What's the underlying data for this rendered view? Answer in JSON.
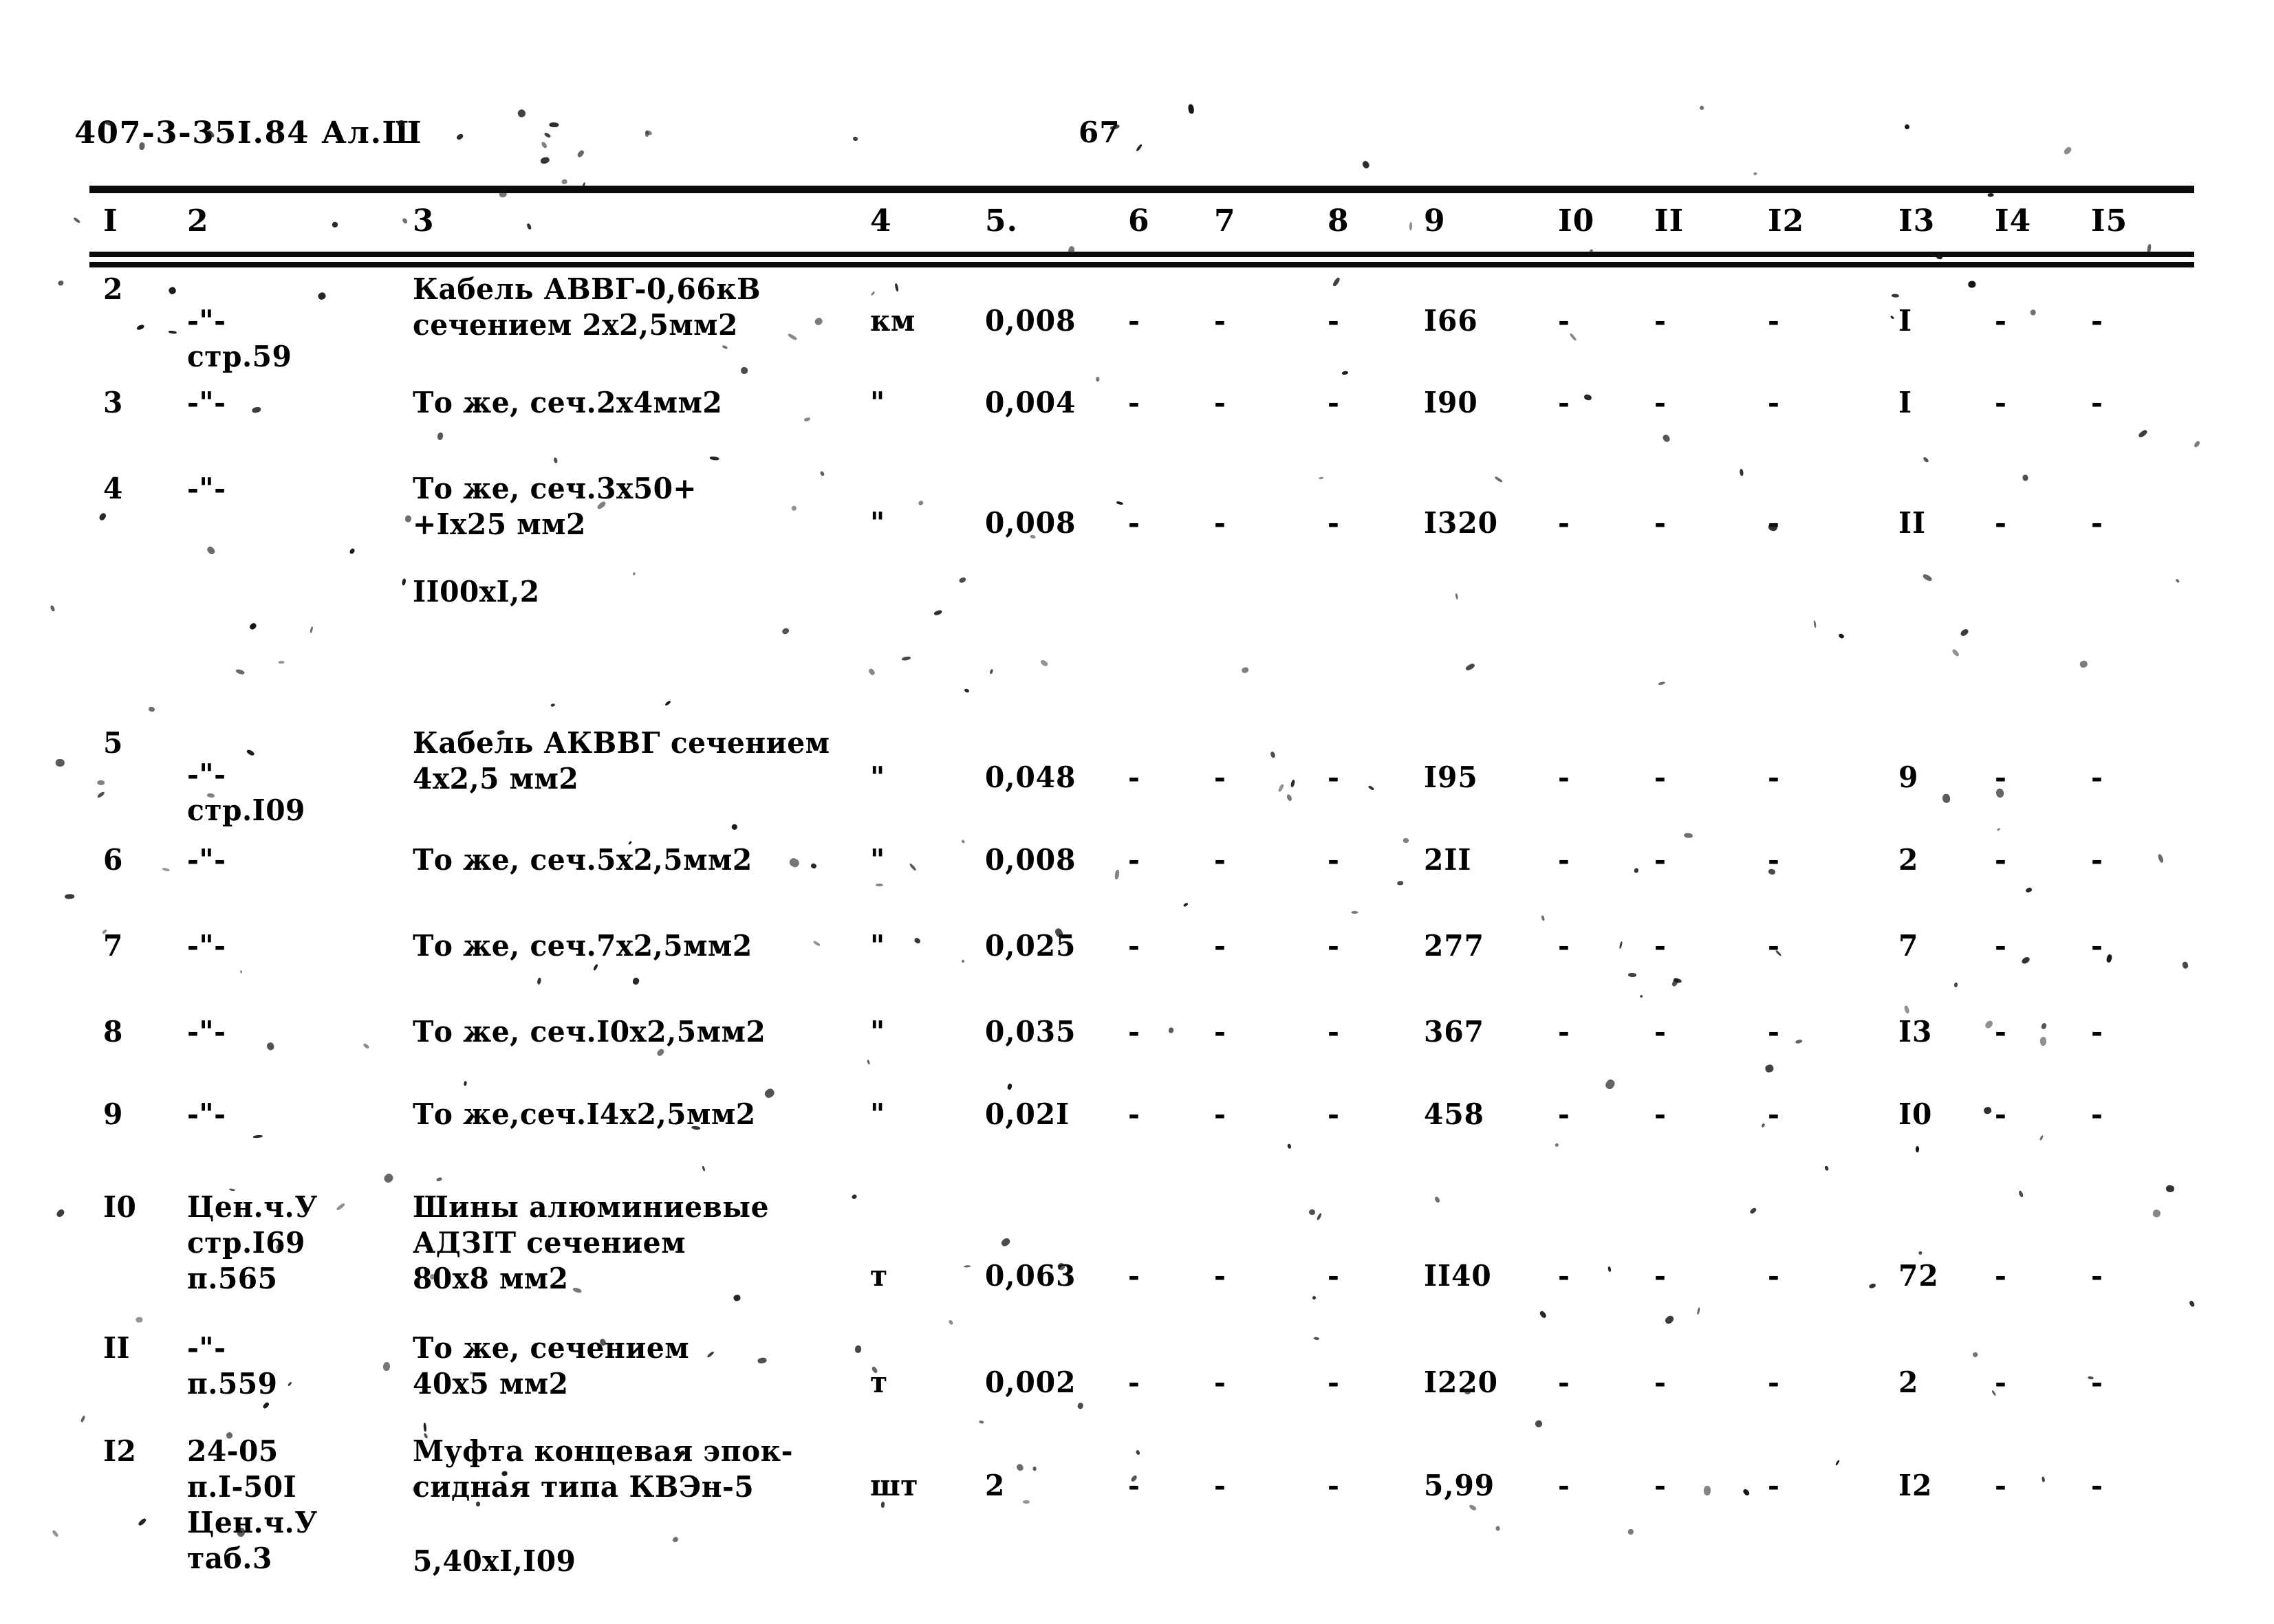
{
  "header": {
    "doc_code": "407-3-35I.84 Ал.Ш",
    "page_number": "67"
  },
  "table": {
    "column_headers": [
      "I",
      "2",
      "3",
      "4",
      "5.",
      "6",
      "7",
      "8",
      "9",
      "I0",
      "II",
      "I2",
      "I3",
      "I4",
      "I5"
    ],
    "rows": [
      {
        "c1": "2",
        "c2": "-\"-\nстр.59",
        "c3": "Кабель АВВГ-0,66кВ\nсечением 2х2,5мм2",
        "c4": "км",
        "c5": "0,008",
        "c6": "-",
        "c7": "-",
        "c8": "-",
        "c9": "I66",
        "c10": "-",
        "c11": "-",
        "c12": "-",
        "c13": "I",
        "c14": "-",
        "c15": "-"
      },
      {
        "c1": "3",
        "c2": "-\"-",
        "c3": "То же, сеч.2х4мм2",
        "c4": "\"",
        "c5": "0,004",
        "c6": "-",
        "c7": "-",
        "c8": "-",
        "c9": "I90",
        "c10": "-",
        "c11": "-",
        "c12": "-",
        "c13": "I",
        "c14": "-",
        "c15": "-"
      },
      {
        "c1": "4",
        "c2": "-\"-",
        "c3": "То же, сеч.3х50+\n+Iх25 мм2",
        "c3_extra": "II00xI,2",
        "c4": "\"",
        "c5": "0,008",
        "c6": "-",
        "c7": "-",
        "c8": "-",
        "c9": "I320",
        "c10": "-",
        "c11": "-",
        "c12": "-",
        "c13": "II",
        "c14": "-",
        "c15": "-"
      },
      {
        "c1": "5",
        "c2": "-\"-\nстр.I09",
        "c3": "Кабель АКВВГ сечением\n4х2,5 мм2",
        "c4": "\"",
        "c5": "0,048",
        "c6": "-",
        "c7": "-",
        "c8": "-",
        "c9": "I95",
        "c10": "-",
        "c11": "-",
        "c12": "-",
        "c13": "9",
        "c14": "-",
        "c15": "-"
      },
      {
        "c1": "6",
        "c2": "-\"-",
        "c3": "То же, сеч.5х2,5мм2",
        "c4": "\"",
        "c5": "0,008",
        "c6": "-",
        "c7": "-",
        "c8": "-",
        "c9": "2II",
        "c10": "-",
        "c11": "-",
        "c12": "-",
        "c13": "2",
        "c14": "-",
        "c15": "-"
      },
      {
        "c1": "7",
        "c2": "-\"-",
        "c3": "То же, сеч.7х2,5мм2",
        "c4": "\"",
        "c5": "0,025",
        "c6": "-",
        "c7": "-",
        "c8": "-",
        "c9": "277",
        "c10": "-",
        "c11": "-",
        "c12": "-",
        "c13": "7",
        "c14": "-",
        "c15": "-"
      },
      {
        "c1": "8",
        "c2": "-\"-",
        "c3": "То же, сеч.I0х2,5мм2",
        "c4": "\"",
        "c5": "0,035",
        "c6": "-",
        "c7": "-",
        "c8": "-",
        "c9": "367",
        "c10": "-",
        "c11": "-",
        "c12": "-",
        "c13": "I3",
        "c14": "-",
        "c15": "-"
      },
      {
        "c1": "9",
        "c2": "-\"-",
        "c3": "То же,сеч.I4х2,5мм2",
        "c4": "\"",
        "c5": "0,02I",
        "c6": "-",
        "c7": "-",
        "c8": "-",
        "c9": "458",
        "c10": "-",
        "c11": "-",
        "c12": "-",
        "c13": "I0",
        "c14": "-",
        "c15": "-"
      },
      {
        "c1": "I0",
        "c2": "Цен.ч.У\nстр.I69\nп.565",
        "c3": "Шины алюминиевые\nАДЗIТ сечением\n80х8 мм2",
        "c4": "т",
        "c5": "0,063",
        "c6": "-",
        "c7": "-",
        "c8": "-",
        "c9": "II40",
        "c10": "-",
        "c11": "-",
        "c12": "-",
        "c13": "72",
        "c14": "-",
        "c15": "-"
      },
      {
        "c1": "II",
        "c2": "-\"-\nп.559",
        "c3": "То же, сечением\n40х5 мм2",
        "c4": "т",
        "c5": "0,002",
        "c6": "-",
        "c7": "-",
        "c8": "-",
        "c9": "I220",
        "c10": "-",
        "c11": "-",
        "c12": "-",
        "c13": "2",
        "c14": "-",
        "c15": "-"
      },
      {
        "c1": "I2",
        "c2": "24-05\nп.I-50I\nЦен.ч.У\nтаб.3",
        "c3": "Муфта концевая эпок-\nсидная типа КВЭн-5",
        "c3_extra": "5,40xI,I09",
        "c4": "шт",
        "c5": "2",
        "c6": "-",
        "c7": "-",
        "c8": "-",
        "c9": "5,99",
        "c10": "-",
        "c11": "-",
        "c12": "-",
        "c13": "I2",
        "c14": "-",
        "c15": "-"
      }
    ]
  }
}
